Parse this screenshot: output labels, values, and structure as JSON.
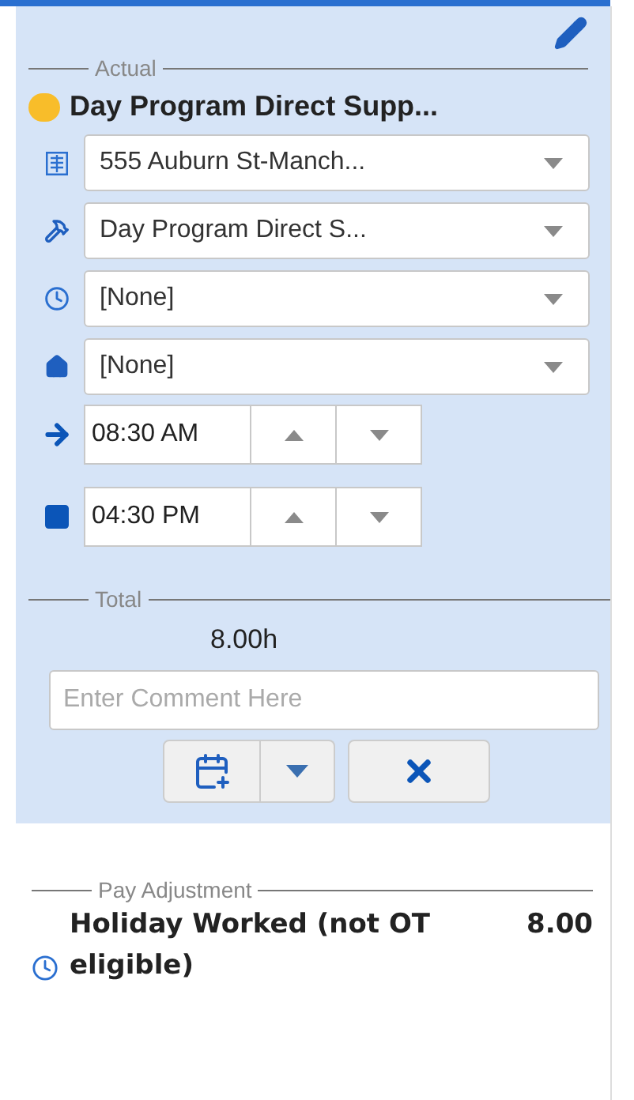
{
  "actual": {
    "legend": "Actual",
    "status": {
      "color": "#f8bd2a"
    },
    "title": "Day Program Direct Supp...",
    "selects": [
      {
        "kind": "location",
        "value": "555 Auburn St-Manch..."
      },
      {
        "kind": "task",
        "value": "Day Program Direct S..."
      },
      {
        "kind": "clock",
        "value": "[None]"
      },
      {
        "kind": "home",
        "value": "[None]"
      }
    ],
    "times": [
      {
        "kind": "start",
        "value": "08:30 AM"
      },
      {
        "kind": "end",
        "value": "04:30 PM"
      }
    ]
  },
  "total": {
    "legend": "Total",
    "value": "8.00h",
    "comment_placeholder": "Enter Comment Here"
  },
  "pay_adjustment": {
    "legend": "Pay Adjustment",
    "name": "Holiday Worked (not OT eligible)",
    "amount": "8.00"
  }
}
